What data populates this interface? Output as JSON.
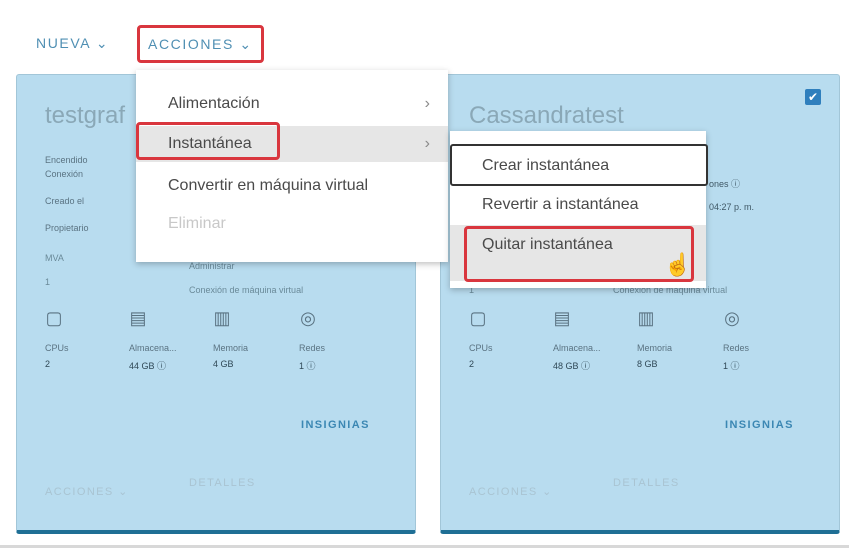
{
  "toolbar": {
    "nueva_label": "NUEVA ⌄",
    "acciones_label": "ACCIONES ⌄"
  },
  "card1": {
    "title": "testgraf",
    "props": [
      "Encendido",
      "Conexión",
      "Creado el",
      "Propietario"
    ],
    "mva_label": "MVA",
    "mva_value": "1",
    "mva_sub1": "Administrar",
    "mva_sub2": "Conexión de máquina virtual",
    "resources": [
      {
        "icon": "cpu-icon",
        "label": "CPUs",
        "value": "2"
      },
      {
        "icon": "storage-icon",
        "label": "Almacena...",
        "value": "44 GB ⓘ"
      },
      {
        "icon": "memory-icon",
        "label": "Memoria",
        "value": "4 GB"
      },
      {
        "icon": "network-icon",
        "label": "Redes",
        "value": "1 ⓘ"
      }
    ],
    "insignias": "INSIGNIAS",
    "acciones_footer": "ACCIONES ⌄",
    "detalles_footer": "DETALLES"
  },
  "card2": {
    "title": "Cassandratest",
    "props_right1": "ones ⓘ",
    "props_right2": "04:27 p. m.",
    "mva_value": "1",
    "mva_sub2": "Conexión de máquina virtual",
    "resources": [
      {
        "icon": "cpu-icon",
        "label": "CPUs",
        "value": "2"
      },
      {
        "icon": "storage-icon",
        "label": "Almacena...",
        "value": "48 GB ⓘ"
      },
      {
        "icon": "memory-icon",
        "label": "Memoria",
        "value": "8 GB"
      },
      {
        "icon": "network-icon",
        "label": "Redes",
        "value": "1 ⓘ"
      }
    ],
    "insignias": "INSIGNIAS",
    "acciones_footer": "ACCIONES ⌄",
    "detalles_footer": "DETALLES"
  },
  "menu": {
    "items": [
      {
        "label": "Alimentación",
        "has_submenu": true
      },
      {
        "label": "Instantánea",
        "has_submenu": true
      },
      {
        "label": "Convertir en máquina virtual",
        "has_submenu": false
      },
      {
        "label": "Eliminar",
        "has_submenu": false,
        "disabled": true
      }
    ],
    "chevron": "›"
  },
  "submenu": {
    "items": [
      {
        "label": "Crear instantánea"
      },
      {
        "label": "Revertir a instantánea"
      },
      {
        "label": "Quitar instantánea"
      }
    ]
  },
  "checkbox_mark": "✔",
  "cursor_glyph": "☝",
  "colors": {
    "accent": "#3b87b3",
    "highlight_border": "#d9363e",
    "card_bg": "#b8dcef"
  }
}
